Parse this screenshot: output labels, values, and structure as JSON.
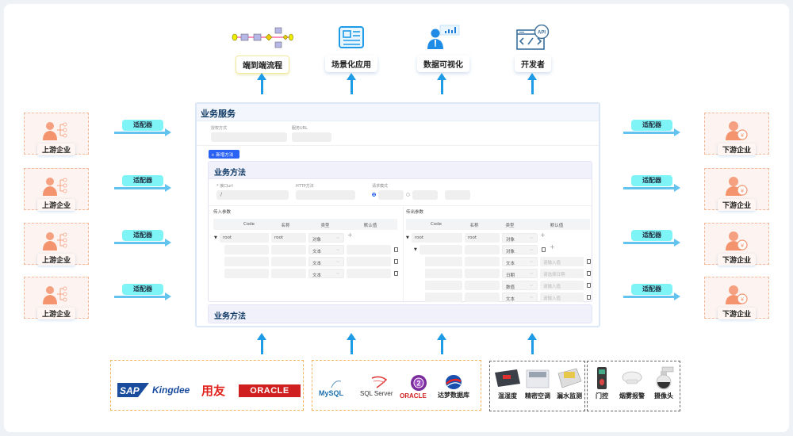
{
  "capabilities": [
    {
      "label": "端到端流程",
      "icon": "process-flow-icon"
    },
    {
      "label": "场景化应用",
      "icon": "newspaper-icon"
    },
    {
      "label": "数据可视化",
      "icon": "analyst-chart-icon"
    },
    {
      "label": "开发者",
      "icon": "api-code-icon"
    }
  ],
  "upstream": [
    {
      "label": "上游企业"
    },
    {
      "label": "上游企业"
    },
    {
      "label": "上游企业"
    },
    {
      "label": "上游企业"
    }
  ],
  "downstream": [
    {
      "label": "下游企业"
    },
    {
      "label": "下游企业"
    },
    {
      "label": "下游企业"
    },
    {
      "label": "下游企业"
    }
  ],
  "adapter_label": "适配器",
  "service": {
    "title": "业务服务",
    "auth_label": "授权方式",
    "url_label": "服务URL",
    "add_method_button": "+ 新增方法",
    "method": {
      "title": "业务方法",
      "url_label": "* 接口url",
      "url_value": "/",
      "http_label": "HTTP方法",
      "mode_label": "请求模式",
      "input_params": {
        "title": "传入参数",
        "columns": [
          "Code",
          "名称",
          "类型",
          "默认值"
        ],
        "root": {
          "code": "root",
          "name": "root",
          "type": "对象"
        },
        "rows": [
          {
            "type": "文本",
            "default": ""
          },
          {
            "type": "文本",
            "default": ""
          },
          {
            "type": "文本",
            "default": ""
          }
        ]
      },
      "output_params": {
        "title": "传出参数",
        "columns": [
          "Code",
          "名称",
          "类型",
          "默认值"
        ],
        "root": {
          "code": "root",
          "name": "root",
          "type": "对象"
        },
        "child": {
          "type": "对象"
        },
        "rows": [
          {
            "type": "文本",
            "placeholder": "请输入值"
          },
          {
            "type": "日期",
            "placeholder": "请选择日期"
          },
          {
            "type": "数值",
            "placeholder": "请输入值"
          },
          {
            "type": "文本",
            "placeholder": "请输入值"
          }
        ]
      }
    },
    "method2_title": "业务方法"
  },
  "sources": {
    "erp": [
      "SAP",
      "Kingdee",
      "用友",
      "ORACLE"
    ],
    "databases": [
      "MySQL",
      "SQL Server",
      "ORACLE",
      "达梦数据库"
    ],
    "sensors": [
      "温湿度",
      "精密空调",
      "漏水监测"
    ],
    "security": [
      "门控",
      "烟雾报警",
      "摄像头"
    ]
  },
  "colors": {
    "arrow": "#1e9be6",
    "adapter": "#7ef4f6",
    "enterprise_border": "#f3b999",
    "primary_button": "#2a62f3",
    "title_text": "#0f3a66"
  }
}
